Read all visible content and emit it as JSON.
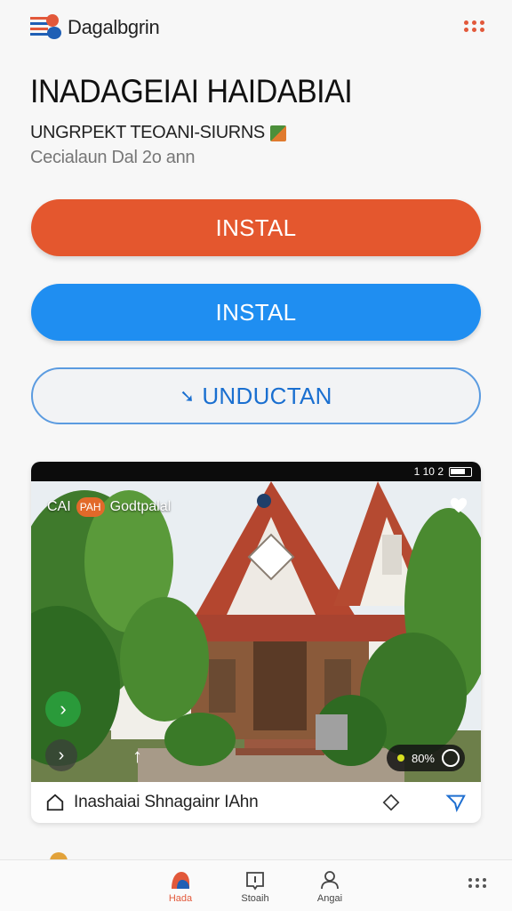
{
  "header": {
    "app_name": "Dagalbgrin",
    "logo_icon": "stacked-layers-icon",
    "menu_icon": "grid-dots-icon"
  },
  "app": {
    "title": "INADAGEIAI HAIDABIAI",
    "subtitle": "UNGRPEKT TEOANI-SIURNS",
    "subtitle_badge_icon": "category-badge-icon",
    "meta": "Cecialaun Dal 2o ann"
  },
  "actions": {
    "primary_label": "INSTAL",
    "secondary_label": "INSTAL",
    "download_label": "UNDUCTAN",
    "download_icon": "download-arrow-icon"
  },
  "preview": {
    "status_time": "1 10 2",
    "label": "CAI",
    "chip": "PAH",
    "label_name": "Godtpalal",
    "zoom": "80%",
    "caption": "Inashaiai Shnagainr IAhn",
    "caption_icons": [
      "home-icon",
      "diamond-icon",
      "send-icon"
    ]
  },
  "nav": {
    "items": [
      {
        "label": "Hada",
        "icon": "home-blob-icon"
      },
      {
        "label": "Stoaih",
        "icon": "alert-box-icon"
      },
      {
        "label": "Angai",
        "icon": "person-icon"
      }
    ],
    "more_icon": "more-dots-icon"
  },
  "colors": {
    "accent_orange": "#e4572e",
    "accent_blue": "#1f8ef1",
    "outline_blue": "#5b9be0"
  }
}
